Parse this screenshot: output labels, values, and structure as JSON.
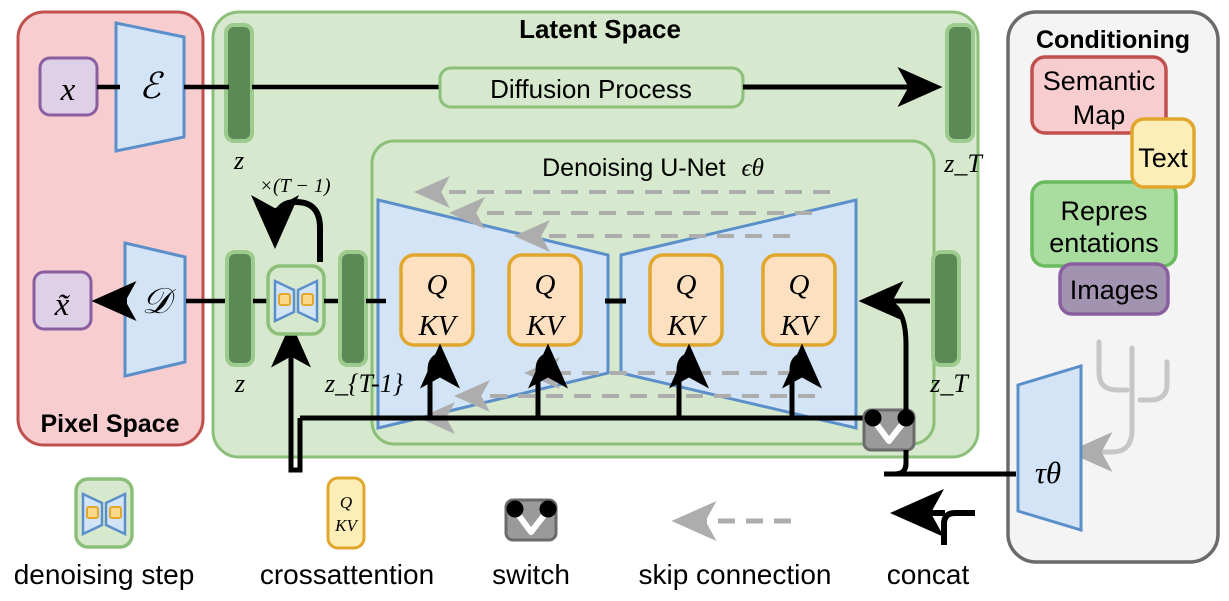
{
  "diagram": {
    "title": "Latent Diffusion Model architecture",
    "panels": {
      "pixel_space": {
        "label": "Pixel Space",
        "fill": "#f7cdd0",
        "stroke": "#c0504d"
      },
      "latent_space": {
        "label": "Latent Space",
        "fill": "#d6e8cd",
        "stroke": "#8cc07a"
      },
      "denoising_unet": {
        "label": "Denoising U-Net",
        "subscript_symbol": "ϵθ",
        "fill": "#d6e8cd",
        "stroke": "#8cc07a"
      },
      "conditioning": {
        "label": "Conditioning",
        "fill": "#f4f4f4",
        "stroke": "#6b6b6b"
      }
    },
    "pixel_space_nodes": {
      "input_image": "x",
      "output_image": "x̃",
      "encoder": "ℰ",
      "decoder": "𝒟"
    },
    "latent_nodes": {
      "z_left_top": "z",
      "z_left_bottom": "z",
      "z_t_top": "z_T",
      "z_t_bottom": "z_T",
      "z_t_minus_1": "z_{T-1}",
      "diffusion_process": "Diffusion Process",
      "loop_label": "×(T − 1)"
    },
    "attention_blocks": [
      {
        "q": "Q",
        "kv": "KV"
      },
      {
        "q": "Q",
        "kv": "KV"
      },
      {
        "q": "Q",
        "kv": "KV"
      },
      {
        "q": "Q",
        "kv": "KV"
      }
    ],
    "conditioning_items": [
      {
        "label": "Semantic Map",
        "line1": "Semantic",
        "line2": "Map",
        "fill": "#f7cdd0",
        "stroke": "#c0504d"
      },
      {
        "label": "Text",
        "line1": "Text",
        "line2": "",
        "fill": "#fdeeb8",
        "stroke": "#e0a72c"
      },
      {
        "label": "Representations",
        "line1": "Repres",
        "line2": "entations",
        "fill": "#a9dda0",
        "stroke": "#6aba5e"
      },
      {
        "label": "Images",
        "line1": "Images",
        "line2": "",
        "fill": "#a294b0",
        "stroke": "#8a5fa0"
      }
    ],
    "conditioning_encoder": "τθ",
    "legend": [
      {
        "icon": "denoising-step-icon",
        "label": "denoising step"
      },
      {
        "icon": "crossattention-icon",
        "label": "crossattention",
        "q": "Q",
        "kv": "KV"
      },
      {
        "icon": "switch-icon",
        "label": "switch"
      },
      {
        "icon": "skip-connection-icon",
        "label": "skip connection"
      },
      {
        "icon": "concat-icon",
        "label": "concat"
      }
    ],
    "colors": {
      "latent_bar": "#5c8a56",
      "latent_bar_border": "#9ccb8d",
      "trapezoid_fill": "#d4e4f7",
      "trapezoid_stroke": "#5b8fc9",
      "attention_fill": "#fce0c0",
      "attention_stroke": "#e0a72c",
      "skip_gray": "#adadad",
      "switch_gray": "#9a9a9a",
      "line_black": "#000000"
    }
  }
}
